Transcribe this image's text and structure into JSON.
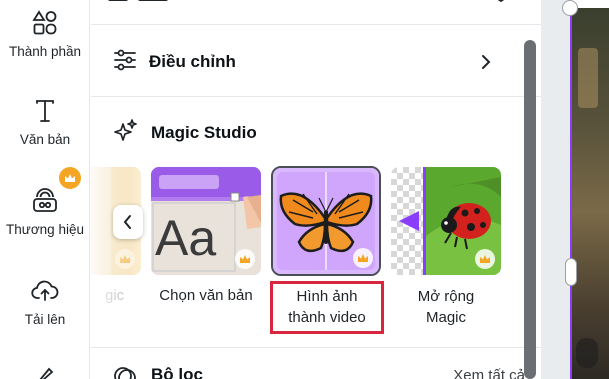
{
  "rail": {
    "items": [
      {
        "label": "Thành phần",
        "icon": "elements-icon"
      },
      {
        "label": "Văn bản",
        "icon": "text-icon"
      },
      {
        "label": "Thương hiệu",
        "icon": "brand-icon",
        "premium": true
      },
      {
        "label": "Tải lên",
        "icon": "upload-icon"
      }
    ]
  },
  "panel": {
    "adjust_label": "Điều chỉnh",
    "magic_studio_label": "Magic Studio",
    "cards": [
      {
        "label": "gic",
        "name": "card-partial"
      },
      {
        "label": "Chọn văn bản",
        "name": "card-grab-text"
      },
      {
        "label_line1": "Hình ảnh",
        "label_line2": "thành video",
        "name": "card-image-to-video"
      },
      {
        "label_line1": "Mở rộng",
        "label_line2": "Magic",
        "name": "card-magic-expand"
      }
    ],
    "filter_label": "Bộ lọc",
    "see_all_label": "Xem tất cả"
  },
  "colors": {
    "accent": "#8b3dff",
    "premium": "#f5a524",
    "highlight": "#d7263d",
    "selected_card_bg": "#d9b8ff"
  }
}
